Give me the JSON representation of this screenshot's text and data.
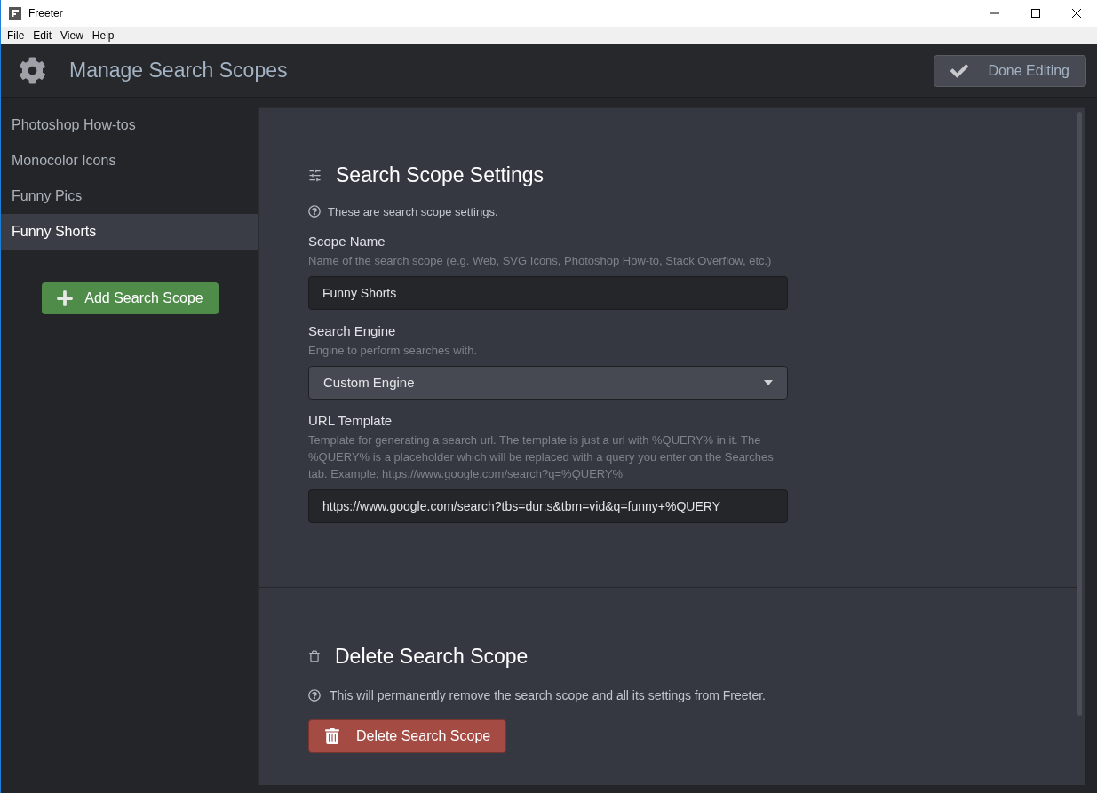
{
  "window": {
    "title": "Freeter"
  },
  "menu": [
    "File",
    "Edit",
    "View",
    "Help"
  ],
  "header": {
    "title": "Manage Search Scopes",
    "done_button": "Done Editing"
  },
  "sidebar": {
    "items": [
      {
        "label": "Photoshop How-tos",
        "selected": false
      },
      {
        "label": "Monocolor Icons",
        "selected": false
      },
      {
        "label": "Funny Pics",
        "selected": false
      },
      {
        "label": "Funny Shorts",
        "selected": true
      }
    ],
    "add_button": "Add Search Scope"
  },
  "settings": {
    "title": "Search Scope Settings",
    "hint": "These are search scope settings.",
    "fields": [
      {
        "kind": "text",
        "label": "Scope Name",
        "description": "Name of the search scope (e.g. Web, SVG Icons, Photoshop How-to, Stack Overflow, etc.)",
        "value": "Funny Shorts"
      },
      {
        "kind": "select",
        "label": "Search Engine",
        "description": "Engine to perform searches with.",
        "value": "Custom Engine"
      },
      {
        "kind": "text",
        "label": "URL Template",
        "description": "Template for generating a search url. The template is just a url with %QUERY% in it. The %QUERY% is a placeholder which will be replaced with a query you enter on the Searches tab. Example: https://www.google.com/search?q=%QUERY%",
        "value": "https://www.google.com/search?tbs=dur:s&tbm=vid&q=funny+%QUERY"
      }
    ]
  },
  "delete": {
    "title": "Delete Search Scope",
    "hint": "This will permanently remove the search scope and all its settings from Freeter.",
    "button": "Delete Search Scope"
  }
}
